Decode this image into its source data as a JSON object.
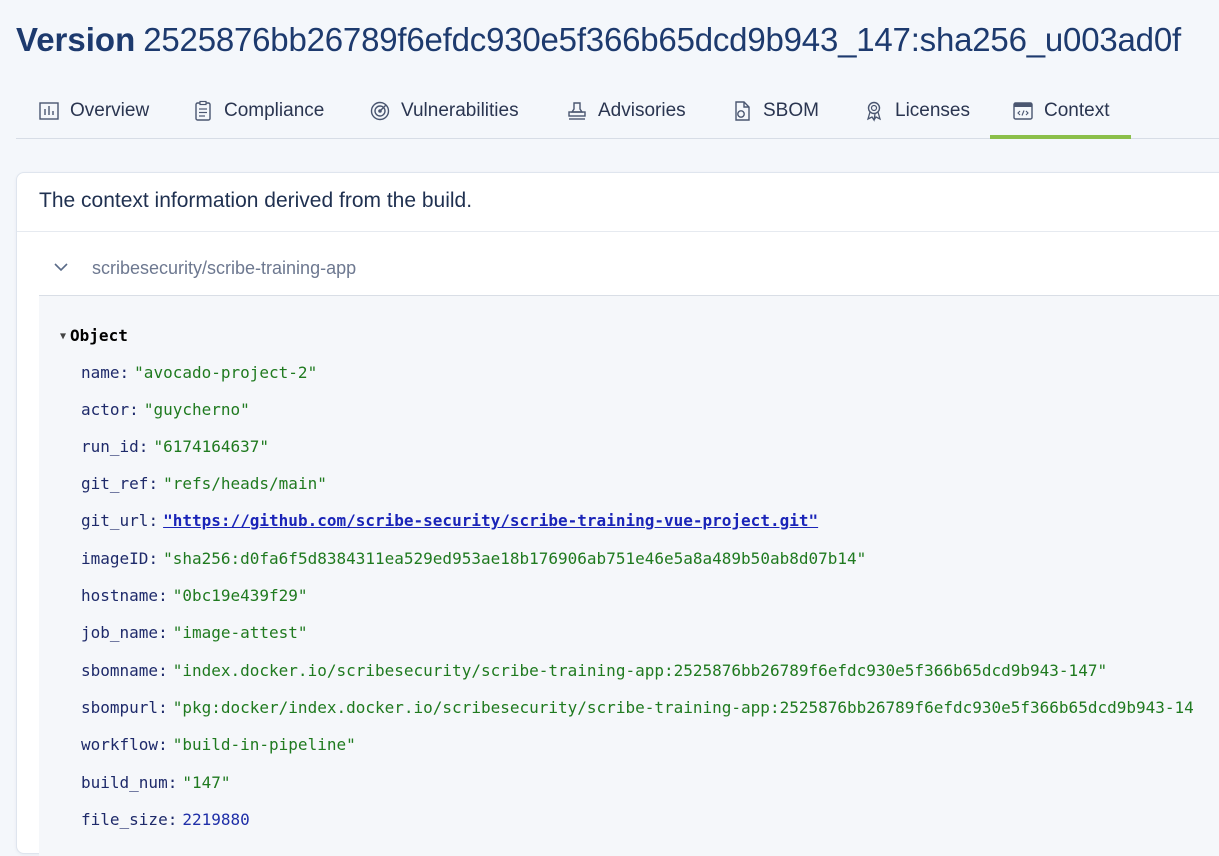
{
  "header": {
    "label": "Version",
    "version_id": "2525876bb26789f6efdc930e5f366b65dcd9b943_147:sha256_u003ad0f",
    "more": "⋮"
  },
  "tabs": [
    {
      "label": "Overview",
      "icon": "chart-icon"
    },
    {
      "label": "Compliance",
      "icon": "clipboard-icon"
    },
    {
      "label": "Vulnerabilities",
      "icon": "radar-icon"
    },
    {
      "label": "Advisories",
      "icon": "stamp-icon"
    },
    {
      "label": "SBOM",
      "icon": "file-settings-icon"
    },
    {
      "label": "Licenses",
      "icon": "award-icon"
    },
    {
      "label": "Context",
      "icon": "code-window-icon",
      "active": true
    }
  ],
  "card": {
    "title": "The context information derived from the build.",
    "accordion_title": "scribesecurity/scribe-training-app"
  },
  "json": {
    "root_label": "Object",
    "rows": [
      {
        "key": "name",
        "value": "\"avocado-project-2\"",
        "type": "str"
      },
      {
        "key": "actor",
        "value": "\"guycherno\"",
        "type": "str"
      },
      {
        "key": "run_id",
        "value": "\"6174164637\"",
        "type": "str"
      },
      {
        "key": "git_ref",
        "value": "\"refs/heads/main\"",
        "type": "str"
      },
      {
        "key": "git_url",
        "value": "\"https://github.com/scribe-security/scribe-training-vue-project.git\"",
        "type": "link"
      },
      {
        "key": "imageID",
        "value": "\"sha256:d0fa6f5d8384311ea529ed953ae18b176906ab751e46e5a8a489b50ab8d07b14\"",
        "type": "str"
      },
      {
        "key": "hostname",
        "value": "\"0bc19e439f29\"",
        "type": "str"
      },
      {
        "key": "job_name",
        "value": "\"image-attest\"",
        "type": "str"
      },
      {
        "key": "sbomname",
        "value": "\"index.docker.io/scribesecurity/scribe-training-app:2525876bb26789f6efdc930e5f366b65dcd9b943-147\"",
        "type": "str"
      },
      {
        "key": "sbompurl",
        "value": "\"pkg:docker/index.docker.io/scribesecurity/scribe-training-app:2525876bb26789f6efdc930e5f366b65dcd9b943-14",
        "type": "str"
      },
      {
        "key": "workflow",
        "value": "\"build-in-pipeline\"",
        "type": "str"
      },
      {
        "key": "build_num",
        "value": "\"147\"",
        "type": "str"
      },
      {
        "key": "file_size",
        "value": "2219880",
        "type": "num"
      }
    ]
  },
  "colors": {
    "accent": "#8bbf4a",
    "title": "#1d3a6e",
    "json_string": "#1f7a1f",
    "json_key": "#1e2a6a"
  }
}
